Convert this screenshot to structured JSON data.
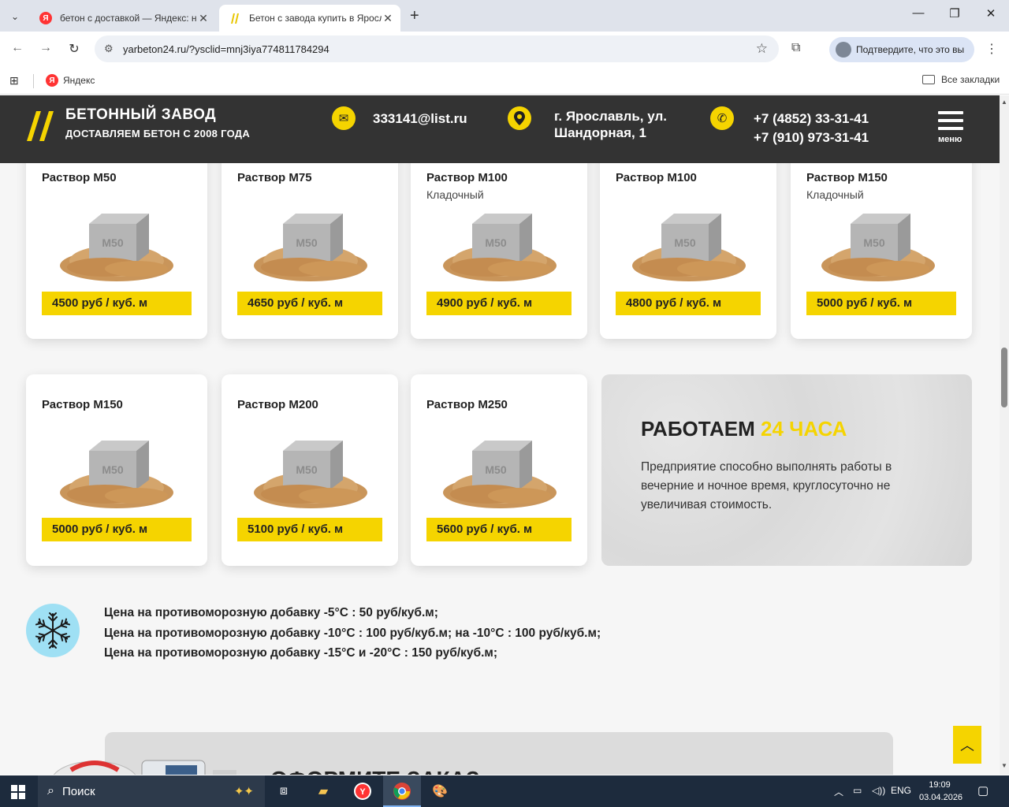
{
  "browser": {
    "tabs": [
      {
        "title": "бетон с доставкой — Яндекс: н",
        "active": false,
        "favicon": "Я"
      },
      {
        "title": "Бетон с завода купить в Яросла",
        "active": true,
        "favicon": "//"
      }
    ],
    "url": "yarbeton24.ru/?ysclid=mnj3iya774811784294",
    "verify_label": "Подтвердите, что это вы",
    "bookmarks": {
      "yandex": "Яндекс",
      "all": "Все закладки",
      "yandex_icon": "Я"
    }
  },
  "header": {
    "logo_title": "БЕТОННЫЙ ЗАВОД",
    "logo_sub": "ДОСТАВЛЯЕМ БЕТОН С 2008 ГОДА",
    "email": "333141@list.ru",
    "address_line1": "г. Ярославль, ул.",
    "address_line2": "Шандорная, 1",
    "phone1": "+7 (4852) 33-31-41",
    "phone2": "+7 (910) 973-31-41",
    "menu_label": "меню",
    "accent_color": "#f5d400"
  },
  "products": [
    {
      "name": "Раствор М50",
      "sub": "",
      "price": "4500 руб / куб. м",
      "stamp": "M50"
    },
    {
      "name": "Раствор М75",
      "sub": "",
      "price": "4650 руб / куб. м",
      "stamp": "M50"
    },
    {
      "name": "Раствор М100",
      "sub": "Кладочный",
      "price": "4900 руб / куб. м",
      "stamp": "M50"
    },
    {
      "name": "Раствор М100",
      "sub": "",
      "price": "4800 руб / куб. м",
      "stamp": "M50"
    },
    {
      "name": "Раствор М150",
      "sub": "Кладочный",
      "price": "5000 руб / куб. м",
      "stamp": "M50"
    },
    {
      "name": "Раствор М150",
      "sub": "",
      "price": "5000 руб / куб. м",
      "stamp": "M50"
    },
    {
      "name": "Раствор М200",
      "sub": "",
      "price": "5100 руб / куб. м",
      "stamp": "M50"
    },
    {
      "name": "Раствор М250",
      "sub": "",
      "price": "5600 руб / куб. м",
      "stamp": "M50"
    }
  ],
  "promo": {
    "title_main": "РАБОТАЕМ",
    "title_highlight": "24 ЧАСА",
    "text": "Предприятие способно выполнять работы в вечерние и ночное время, круглосуточно не увеличивая стоимость."
  },
  "frost": {
    "lines": [
      "Цена на противоморозную добавку -5°С : 50 руб/куб.м;",
      "Цена на противоморозную добавку -10°С : 100 руб/куб.м; на -10°С : 100 руб/куб.м;",
      "Цена на противоморозную добавку -15°С и -20°С : 150 руб/куб.м;"
    ]
  },
  "order": {
    "title": "ОФОРМИТЕ ЗАКАЗ"
  },
  "taskbar": {
    "search_placeholder": "Поиск",
    "lang": "ENG",
    "time": "19:09",
    "date": "03.04.2026"
  }
}
